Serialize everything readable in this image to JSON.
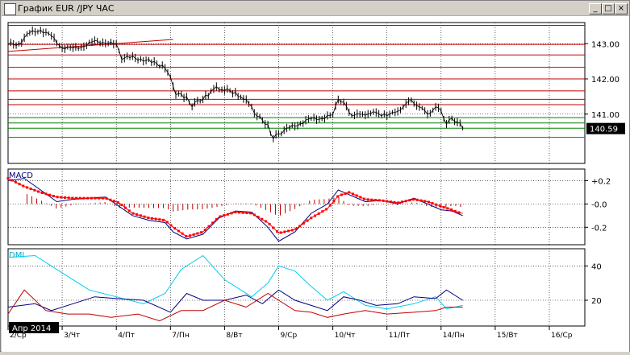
{
  "window": {
    "title": "График EUR /JPY  ЧАС",
    "minimize_label": "_",
    "maximize_label": "□",
    "close_label": "×"
  },
  "colors": {
    "price": "#000000",
    "support": "#008000",
    "resistance": "#c00000",
    "macd_line": "#000080",
    "macd_signal": "#ff0000",
    "macd_hist": "#c00000",
    "dmi_adx": "#00ccee",
    "dmi_plus": "#000080",
    "dmi_minus": "#c00000",
    "grid": "#000000"
  },
  "chart_data": {
    "type": "line",
    "title": "График EUR /JPY  ЧАС",
    "x_ticks": [
      "2/Ср",
      "3/Чт",
      "4/Пт",
      "7/Пн",
      "8/Вт",
      "9/Ср",
      "10/Чт",
      "11/Пт",
      "14/Пн",
      "15/Вт",
      "16/Ср"
    ],
    "period_label": "Апр 2014",
    "price_panel": {
      "y_ticks": [
        143.0,
        142.0,
        141.0
      ],
      "y_tick_labels": [
        "143.00",
        "142.00",
        "141.00"
      ],
      "ylim": [
        139.6,
        143.6
      ],
      "current_price": 140.59,
      "current_price_label": "140.59",
      "resistance_levels": [
        143.52,
        142.98,
        142.68,
        142.33,
        142.0,
        141.66,
        141.42,
        141.27
      ],
      "support_levels": [
        140.9,
        140.75,
        140.6,
        140.34
      ],
      "trendline": [
        [
          0.0,
          142.78
        ],
        [
          3.05,
          143.12
        ]
      ],
      "close": [
        [
          0.0,
          142.98
        ],
        [
          0.2,
          143.0
        ],
        [
          0.4,
          143.3
        ],
        [
          0.6,
          143.4
        ],
        [
          0.8,
          143.2
        ],
        [
          1.0,
          142.9
        ],
        [
          1.2,
          142.85
        ],
        [
          1.4,
          142.95
        ],
        [
          1.6,
          143.05
        ],
        [
          1.8,
          143.05
        ],
        [
          2.0,
          142.95
        ],
        [
          2.1,
          142.6
        ],
        [
          2.3,
          142.6
        ],
        [
          2.5,
          142.55
        ],
        [
          2.7,
          142.45
        ],
        [
          2.9,
          142.35
        ],
        [
          3.0,
          142.0
        ],
        [
          3.1,
          141.6
        ],
        [
          3.3,
          141.45
        ],
        [
          3.4,
          141.25
        ],
        [
          3.5,
          141.35
        ],
        [
          3.7,
          141.55
        ],
        [
          3.85,
          141.75
        ],
        [
          4.0,
          141.7
        ],
        [
          4.2,
          141.6
        ],
        [
          4.35,
          141.45
        ],
        [
          4.5,
          141.2
        ],
        [
          4.6,
          140.95
        ],
        [
          4.8,
          140.7
        ],
        [
          4.9,
          140.3
        ],
        [
          5.0,
          140.45
        ],
        [
          5.2,
          140.6
        ],
        [
          5.4,
          140.75
        ],
        [
          5.6,
          140.85
        ],
        [
          5.8,
          140.9
        ],
        [
          6.0,
          140.95
        ],
        [
          6.1,
          141.45
        ],
        [
          6.2,
          141.3
        ],
        [
          6.35,
          141.0
        ],
        [
          6.5,
          140.95
        ],
        [
          6.65,
          141.05
        ],
        [
          6.8,
          141.0
        ],
        [
          7.0,
          141.0
        ],
        [
          7.15,
          141.0
        ],
        [
          7.3,
          141.25
        ],
        [
          7.45,
          141.35
        ],
        [
          7.6,
          141.25
        ],
        [
          7.75,
          140.95
        ],
        [
          7.9,
          141.25
        ],
        [
          8.0,
          141.05
        ],
        [
          8.1,
          140.75
        ],
        [
          8.2,
          140.85
        ],
        [
          8.3,
          140.8
        ],
        [
          8.4,
          140.6
        ]
      ]
    },
    "macd_panel": {
      "label": "MACD",
      "y_ticks": [
        0.2,
        0.0,
        -0.2
      ],
      "y_tick_labels": [
        "+0.2",
        "-0.0",
        "-0.2"
      ],
      "ylim": [
        -0.35,
        0.3
      ],
      "macd": [
        [
          0.0,
          0.2
        ],
        [
          0.3,
          0.22
        ],
        [
          0.6,
          0.12
        ],
        [
          0.9,
          0.02
        ],
        [
          1.2,
          0.04
        ],
        [
          1.5,
          0.05
        ],
        [
          1.8,
          0.06
        ],
        [
          2.05,
          -0.02
        ],
        [
          2.3,
          -0.1
        ],
        [
          2.6,
          -0.14
        ],
        [
          2.9,
          -0.16
        ],
        [
          3.05,
          -0.24
        ],
        [
          3.3,
          -0.3
        ],
        [
          3.6,
          -0.26
        ],
        [
          3.9,
          -0.12
        ],
        [
          4.2,
          -0.06
        ],
        [
          4.5,
          -0.07
        ],
        [
          4.8,
          -0.2
        ],
        [
          5.0,
          -0.32
        ],
        [
          5.3,
          -0.24
        ],
        [
          5.6,
          -0.08
        ],
        [
          5.9,
          0.0
        ],
        [
          6.1,
          0.12
        ],
        [
          6.3,
          0.08
        ],
        [
          6.6,
          0.02
        ],
        [
          6.9,
          0.03
        ],
        [
          7.2,
          0.0
        ],
        [
          7.5,
          0.05
        ],
        [
          7.75,
          0.0
        ],
        [
          8.0,
          -0.05
        ],
        [
          8.2,
          -0.06
        ],
        [
          8.3,
          -0.08
        ],
        [
          8.4,
          -0.1
        ]
      ],
      "signal": [
        [
          0.0,
          0.22
        ],
        [
          0.3,
          0.15
        ],
        [
          0.6,
          0.1
        ],
        [
          0.9,
          0.06
        ],
        [
          1.2,
          0.05
        ],
        [
          1.5,
          0.05
        ],
        [
          1.8,
          0.05
        ],
        [
          2.05,
          0.01
        ],
        [
          2.3,
          -0.08
        ],
        [
          2.6,
          -0.12
        ],
        [
          2.9,
          -0.14
        ],
        [
          3.05,
          -0.2
        ],
        [
          3.3,
          -0.28
        ],
        [
          3.6,
          -0.24
        ],
        [
          3.9,
          -0.11
        ],
        [
          4.2,
          -0.07
        ],
        [
          4.5,
          -0.08
        ],
        [
          4.8,
          -0.16
        ],
        [
          5.0,
          -0.25
        ],
        [
          5.3,
          -0.22
        ],
        [
          5.6,
          -0.12
        ],
        [
          5.9,
          -0.04
        ],
        [
          6.1,
          0.07
        ],
        [
          6.3,
          0.1
        ],
        [
          6.6,
          0.04
        ],
        [
          6.9,
          0.03
        ],
        [
          7.2,
          0.01
        ],
        [
          7.5,
          0.04
        ],
        [
          7.75,
          0.02
        ],
        [
          8.0,
          -0.02
        ],
        [
          8.2,
          -0.05
        ],
        [
          8.3,
          -0.07
        ],
        [
          8.4,
          -0.08
        ]
      ]
    },
    "dmi_panel": {
      "label": "DMI",
      "y_ticks": [
        40,
        20
      ],
      "y_tick_labels": [
        "40",
        "20"
      ],
      "ylim": [
        5,
        50
      ],
      "adx": [
        [
          0.0,
          45
        ],
        [
          0.5,
          46
        ],
        [
          1.0,
          36
        ],
        [
          1.5,
          26
        ],
        [
          2.0,
          22
        ],
        [
          2.5,
          18
        ],
        [
          2.9,
          24
        ],
        [
          3.2,
          38
        ],
        [
          3.6,
          46
        ],
        [
          4.0,
          32
        ],
        [
          4.5,
          22
        ],
        [
          4.8,
          30
        ],
        [
          5.0,
          40
        ],
        [
          5.3,
          37
        ],
        [
          5.6,
          28
        ],
        [
          5.9,
          20
        ],
        [
          6.2,
          25
        ],
        [
          6.6,
          17
        ],
        [
          7.0,
          15
        ],
        [
          7.5,
          18
        ],
        [
          7.9,
          22
        ],
        [
          8.1,
          15
        ],
        [
          8.4,
          17
        ]
      ],
      "plus_di": [
        [
          0.0,
          16
        ],
        [
          0.5,
          18
        ],
        [
          0.8,
          14
        ],
        [
          1.2,
          18
        ],
        [
          1.6,
          22
        ],
        [
          2.0,
          21
        ],
        [
          2.5,
          20
        ],
        [
          3.0,
          13
        ],
        [
          3.3,
          24
        ],
        [
          3.6,
          20
        ],
        [
          4.0,
          20
        ],
        [
          4.4,
          23
        ],
        [
          4.7,
          18
        ],
        [
          5.0,
          26
        ],
        [
          5.3,
          20
        ],
        [
          5.6,
          17
        ],
        [
          5.9,
          14
        ],
        [
          6.2,
          22
        ],
        [
          6.5,
          20
        ],
        [
          6.8,
          17
        ],
        [
          7.2,
          18
        ],
        [
          7.5,
          22
        ],
        [
          7.9,
          21
        ],
        [
          8.1,
          26
        ],
        [
          8.4,
          20
        ]
      ],
      "minus_di": [
        [
          0.0,
          12
        ],
        [
          0.3,
          26
        ],
        [
          0.7,
          14
        ],
        [
          1.1,
          12
        ],
        [
          1.5,
          12
        ],
        [
          1.9,
          10
        ],
        [
          2.4,
          12
        ],
        [
          2.8,
          8
        ],
        [
          3.2,
          14
        ],
        [
          3.6,
          14
        ],
        [
          4.0,
          20
        ],
        [
          4.4,
          16
        ],
        [
          4.8,
          24
        ],
        [
          5.0,
          20
        ],
        [
          5.3,
          14
        ],
        [
          5.6,
          13
        ],
        [
          5.9,
          10
        ],
        [
          6.2,
          12
        ],
        [
          6.6,
          14
        ],
        [
          7.0,
          12
        ],
        [
          7.5,
          13
        ],
        [
          7.9,
          14
        ],
        [
          8.1,
          16
        ],
        [
          8.4,
          16
        ]
      ]
    }
  }
}
